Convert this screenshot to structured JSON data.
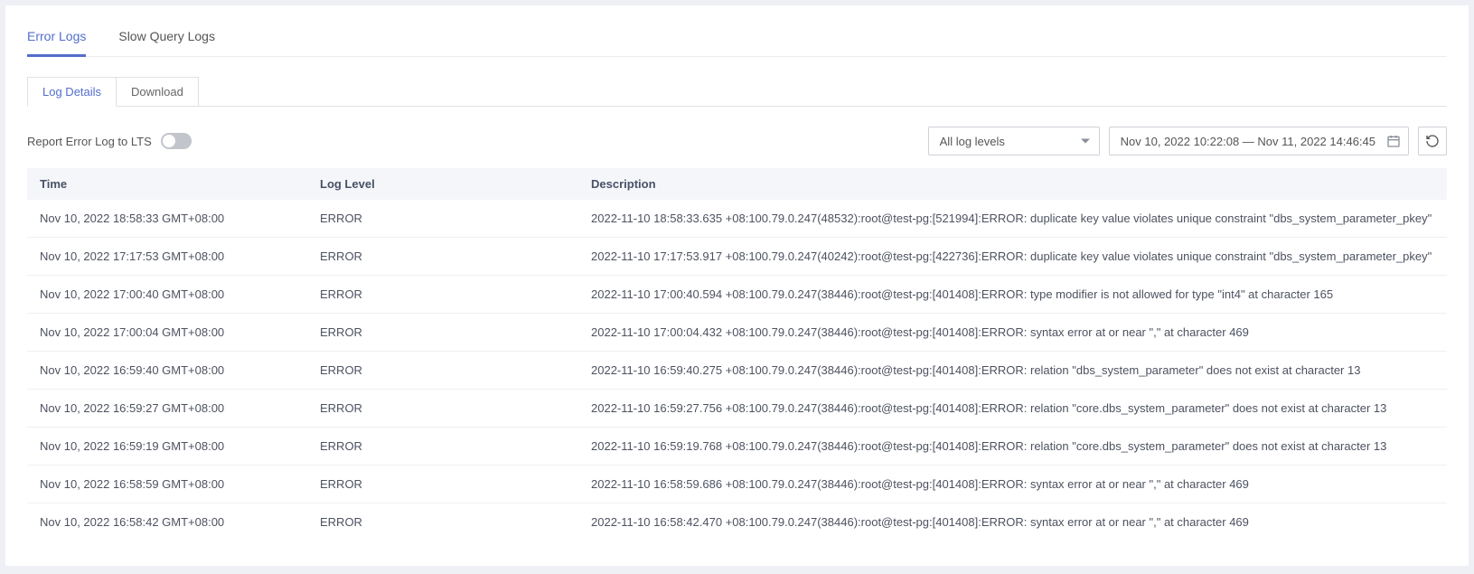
{
  "tabs_primary": {
    "error_logs": "Error Logs",
    "slow_query_logs": "Slow Query Logs"
  },
  "tabs_secondary": {
    "log_details": "Log Details",
    "download": "Download"
  },
  "toolbar": {
    "report_label": "Report Error Log to LTS",
    "log_level_selected": "All log levels",
    "date_range": "Nov 10, 2022 10:22:08 — Nov 11, 2022 14:46:45"
  },
  "columns": {
    "time": "Time",
    "level": "Log Level",
    "description": "Description"
  },
  "rows": [
    {
      "time": "Nov 10, 2022 18:58:33 GMT+08:00",
      "level": "ERROR",
      "description": "2022-11-10 18:58:33.635 +08:100.79.0.247(48532):root@test-pg:[521994]:ERROR: duplicate key value violates unique constraint \"dbs_system_parameter_pkey\""
    },
    {
      "time": "Nov 10, 2022 17:17:53 GMT+08:00",
      "level": "ERROR",
      "description": "2022-11-10 17:17:53.917 +08:100.79.0.247(40242):root@test-pg:[422736]:ERROR: duplicate key value violates unique constraint \"dbs_system_parameter_pkey\""
    },
    {
      "time": "Nov 10, 2022 17:00:40 GMT+08:00",
      "level": "ERROR",
      "description": "2022-11-10 17:00:40.594 +08:100.79.0.247(38446):root@test-pg:[401408]:ERROR: type modifier is not allowed for type \"int4\" at character 165"
    },
    {
      "time": "Nov 10, 2022 17:00:04 GMT+08:00",
      "level": "ERROR",
      "description": "2022-11-10 17:00:04.432 +08:100.79.0.247(38446):root@test-pg:[401408]:ERROR: syntax error at or near \",\" at character 469"
    },
    {
      "time": "Nov 10, 2022 16:59:40 GMT+08:00",
      "level": "ERROR",
      "description": "2022-11-10 16:59:40.275 +08:100.79.0.247(38446):root@test-pg:[401408]:ERROR: relation \"dbs_system_parameter\" does not exist at character 13"
    },
    {
      "time": "Nov 10, 2022 16:59:27 GMT+08:00",
      "level": "ERROR",
      "description": "2022-11-10 16:59:27.756 +08:100.79.0.247(38446):root@test-pg:[401408]:ERROR: relation \"core.dbs_system_parameter\" does not exist at character 13"
    },
    {
      "time": "Nov 10, 2022 16:59:19 GMT+08:00",
      "level": "ERROR",
      "description": "2022-11-10 16:59:19.768 +08:100.79.0.247(38446):root@test-pg:[401408]:ERROR: relation \"core.dbs_system_parameter\" does not exist at character 13"
    },
    {
      "time": "Nov 10, 2022 16:58:59 GMT+08:00",
      "level": "ERROR",
      "description": "2022-11-10 16:58:59.686 +08:100.79.0.247(38446):root@test-pg:[401408]:ERROR: syntax error at or near \",\" at character 469"
    },
    {
      "time": "Nov 10, 2022 16:58:42 GMT+08:00",
      "level": "ERROR",
      "description": "2022-11-10 16:58:42.470 +08:100.79.0.247(38446):root@test-pg:[401408]:ERROR: syntax error at or near \",\" at character 469"
    }
  ]
}
